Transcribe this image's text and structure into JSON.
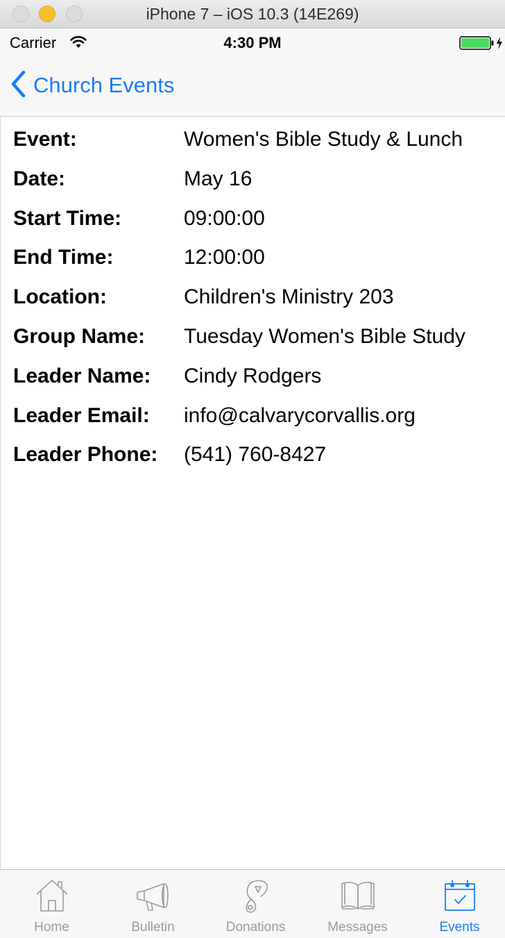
{
  "window": {
    "title": "iPhone 7 – iOS 10.3 (14E269)"
  },
  "status_bar": {
    "carrier": "Carrier",
    "time": "4:30 PM",
    "wifi_icon": "wifi-icon",
    "battery_icon": "battery-charging-icon"
  },
  "nav": {
    "back_label": "Church Events",
    "accent_color": "#1a7cf5"
  },
  "details": [
    {
      "label": "Event:",
      "value": "Women's Bible Study & Lunch"
    },
    {
      "label": "Date:",
      "value": "May 16"
    },
    {
      "label": "Start Time:",
      "value": "09:00:00"
    },
    {
      "label": "End Time:",
      "value": "12:00:00"
    },
    {
      "label": "Location:",
      "value": "Children's Ministry 203"
    },
    {
      "label": "Group Name:",
      "value": "Tuesday Women's Bible Study"
    },
    {
      "label": "Leader Name:",
      "value": "Cindy Rodgers"
    },
    {
      "label": "Leader Email:",
      "value": "info@calvarycorvallis.org"
    },
    {
      "label": "Leader Phone:",
      "value": "(541) 760-8427"
    }
  ],
  "tabs": [
    {
      "label": "Home",
      "icon": "home-icon",
      "active": false
    },
    {
      "label": "Bulletin",
      "icon": "megaphone-icon",
      "active": false
    },
    {
      "label": "Donations",
      "icon": "donation-icon",
      "active": false
    },
    {
      "label": "Messages",
      "icon": "book-icon",
      "active": false
    },
    {
      "label": "Events",
      "icon": "calendar-icon",
      "active": true
    }
  ]
}
